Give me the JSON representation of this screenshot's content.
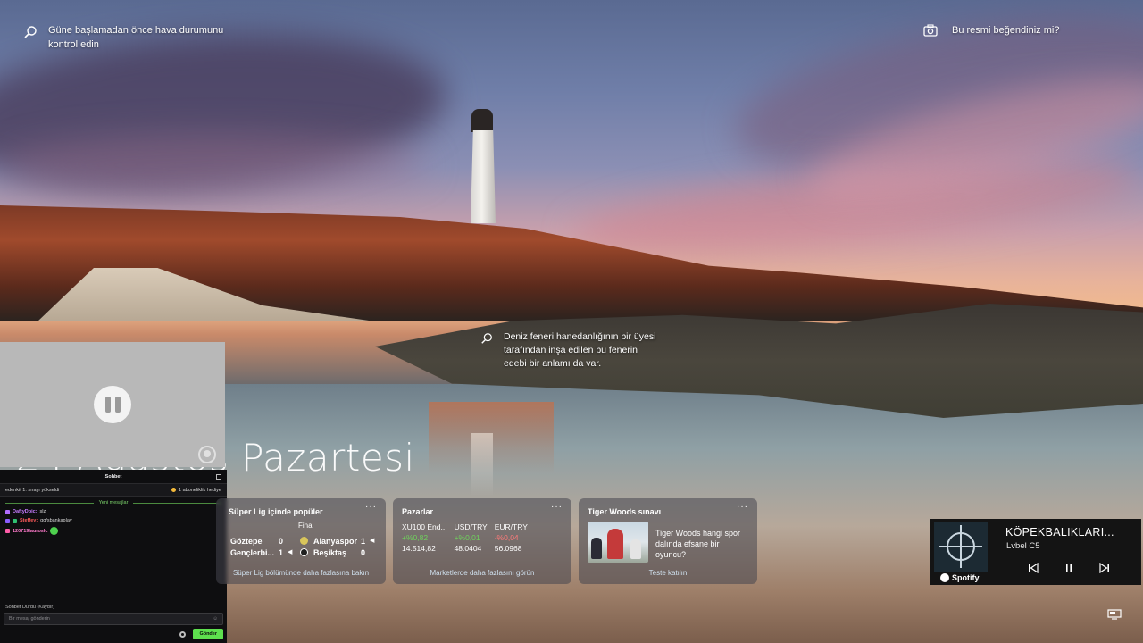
{
  "hints": {
    "weather": "Güne başlamadan önce hava durumunu kontrol edin",
    "like_image": "Bu resmi beğendiniz mi?",
    "lighthouse_fact": "Deniz feneri hanedanlığının bir üyesi tarafından inşa edilen bu fenerin edebi bir anlamı da var."
  },
  "date_text": "24 Ağustos Pazartesi",
  "chat": {
    "title": "Sohbet",
    "info_left": "edenkit 1. sırayı yükseldi",
    "info_right": "1 aboneliklik hediye",
    "new_messages": "Yeni mesajlar",
    "messages": [
      {
        "user": "DaftyDbic:",
        "text": "slz"
      },
      {
        "user": "Steffey:",
        "text": "gg/sbankaplay"
      },
      {
        "user": "120719lauroslc",
        "text": ""
      }
    ],
    "paused": "Sohbet Durdu (Kaydır)",
    "input_placeholder": "Bir mesaj gönderin",
    "send_label": "Gönder"
  },
  "sports": {
    "title": "Süper Lig içinde popüler",
    "col_final": "Final",
    "matches": [
      {
        "home": "Göztepe",
        "home_score": "0",
        "away": "Alanyaspor",
        "away_score": "1"
      },
      {
        "home": "Gençlerbi...",
        "home_score": "1",
        "away": "Beşiktaş",
        "away_score": "0"
      }
    ],
    "link": "Süper Lig bölümünde daha fazlasına bakın",
    "more": "···"
  },
  "markets": {
    "title": "Pazarlar",
    "headers": [
      "XU100 End...",
      "USD/TRY",
      "EUR/TRY"
    ],
    "changes": [
      "+%0,82",
      "+%0,01",
      "-%0,04"
    ],
    "values": [
      "14.514,82",
      "48.0404",
      "56.0968"
    ],
    "link": "Marketlerde daha fazlasını görün",
    "more": "···"
  },
  "quiz": {
    "title": "Tiger Woods sınavı",
    "question": "Tiger Woods hangi spor dalında efsane bir oyuncu?",
    "link": "Teste katılın",
    "more": "···"
  },
  "spotify": {
    "song": "KÖPEKBALIKLARI...",
    "artist": "Lvbel C5",
    "brand": "Spotify"
  },
  "colors": {
    "positive": "#6fd25d",
    "negative": "#ff7a7a",
    "spotify_bg": "#141414",
    "chat_accent": "#5ee04e"
  },
  "icons": [
    "search-icon",
    "camera-icon",
    "pause-icon",
    "cast-icon",
    "gift-icon",
    "gear-icon",
    "emoji-icon",
    "previous-icon",
    "play-pause-icon",
    "next-icon",
    "spotify-logo-icon",
    "display-icon"
  ]
}
